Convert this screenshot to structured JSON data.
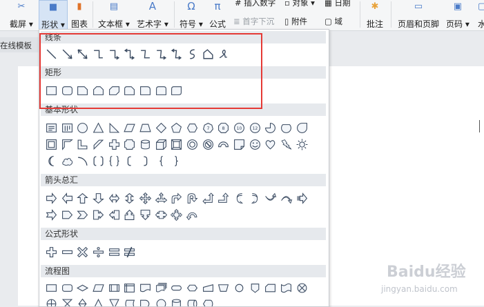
{
  "ribbon": {
    "screenshot_label": "截屏",
    "shape_label": "形状",
    "chart_label": "图表",
    "textbox_label": "文本框",
    "wordart_label": "艺术字",
    "symbol_label": "符号",
    "formula_label": "公式",
    "insert_number_label": "插入数字",
    "object_label": "对象",
    "dropcap_label": "首字下沉",
    "attachment_label": "附件",
    "date_label": "日期",
    "field_label": "域",
    "comment_label": "批注",
    "header_footer_label": "页眉和页脚",
    "page_number_label": "页码",
    "watermark_label": "水",
    "online_template_label": "在线模板"
  },
  "panel": {
    "sections": [
      {
        "title": "线条"
      },
      {
        "title": "矩形"
      },
      {
        "title": "基本形状"
      },
      {
        "title": "箭头总汇"
      },
      {
        "title": "公式形状"
      },
      {
        "title": "流程图"
      }
    ]
  },
  "watermark": {
    "brand": "Baidu经验",
    "url": "jingyan.baidu.com"
  }
}
